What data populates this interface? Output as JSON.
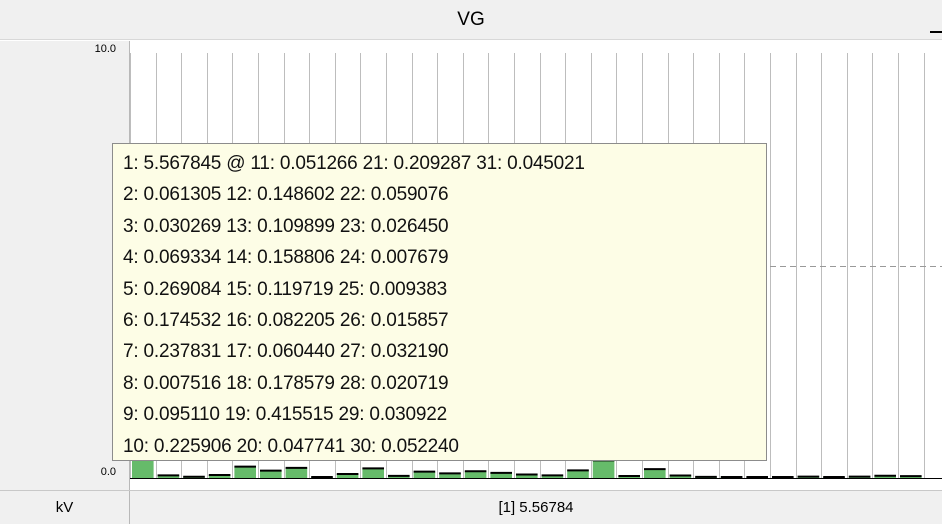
{
  "window": {
    "title": "VG"
  },
  "footer": {
    "unit": "kV",
    "readout": "[1]  5.56784"
  },
  "colors": {
    "bar": "#66bb6a",
    "grid": "#bdbdbd",
    "tooltip_bg": "#fdfde6",
    "reference_line": "#999999"
  },
  "tooltip": {
    "lines": [
      "1: 5.567845 @ 11: 0.051266 21: 0.209287 31: 0.045021",
      "2: 0.061305 12: 0.148602 22: 0.059076",
      "3: 0.030269 13: 0.109899 23: 0.026450",
      "4: 0.069334 14: 0.158806 24: 0.007679",
      "5: 0.269084 15: 0.119719 25: 0.009383",
      "6: 0.174532 16: 0.082205 26: 0.015857",
      "7: 0.237831 17: 0.060440 27: 0.032190",
      "8: 0.007516 18: 0.178579 28: 0.020719",
      "9: 0.095110 19: 0.415515 29: 0.030922",
      "10: 0.225906 20: 0.047741 30: 0.052240"
    ]
  },
  "chart_data": {
    "type": "bar",
    "ylim": [
      0.0,
      10.0
    ],
    "ytick_labels": [
      "10.0",
      "0.0"
    ],
    "reference_line_value": 5.0,
    "categories": [
      "1",
      "2",
      "3",
      "4",
      "5",
      "6",
      "7",
      "8",
      "9",
      "10",
      "11",
      "12",
      "13",
      "14",
      "15",
      "16",
      "17",
      "18",
      "19",
      "20",
      "21",
      "22",
      "23",
      "24",
      "25",
      "26",
      "27",
      "28",
      "29",
      "30",
      "31"
    ],
    "values": [
      5.567845,
      0.061305,
      0.030269,
      0.069334,
      0.269084,
      0.174532,
      0.237831,
      0.007516,
      0.09511,
      0.225906,
      0.051266,
      0.148602,
      0.109899,
      0.158806,
      0.119719,
      0.082205,
      0.06044,
      0.178579,
      0.415515,
      0.047741,
      0.209287,
      0.059076,
      0.02645,
      0.007679,
      0.009383,
      0.015857,
      0.03219,
      0.020719,
      0.030922,
      0.05224,
      0.045021
    ],
    "grid": true
  }
}
